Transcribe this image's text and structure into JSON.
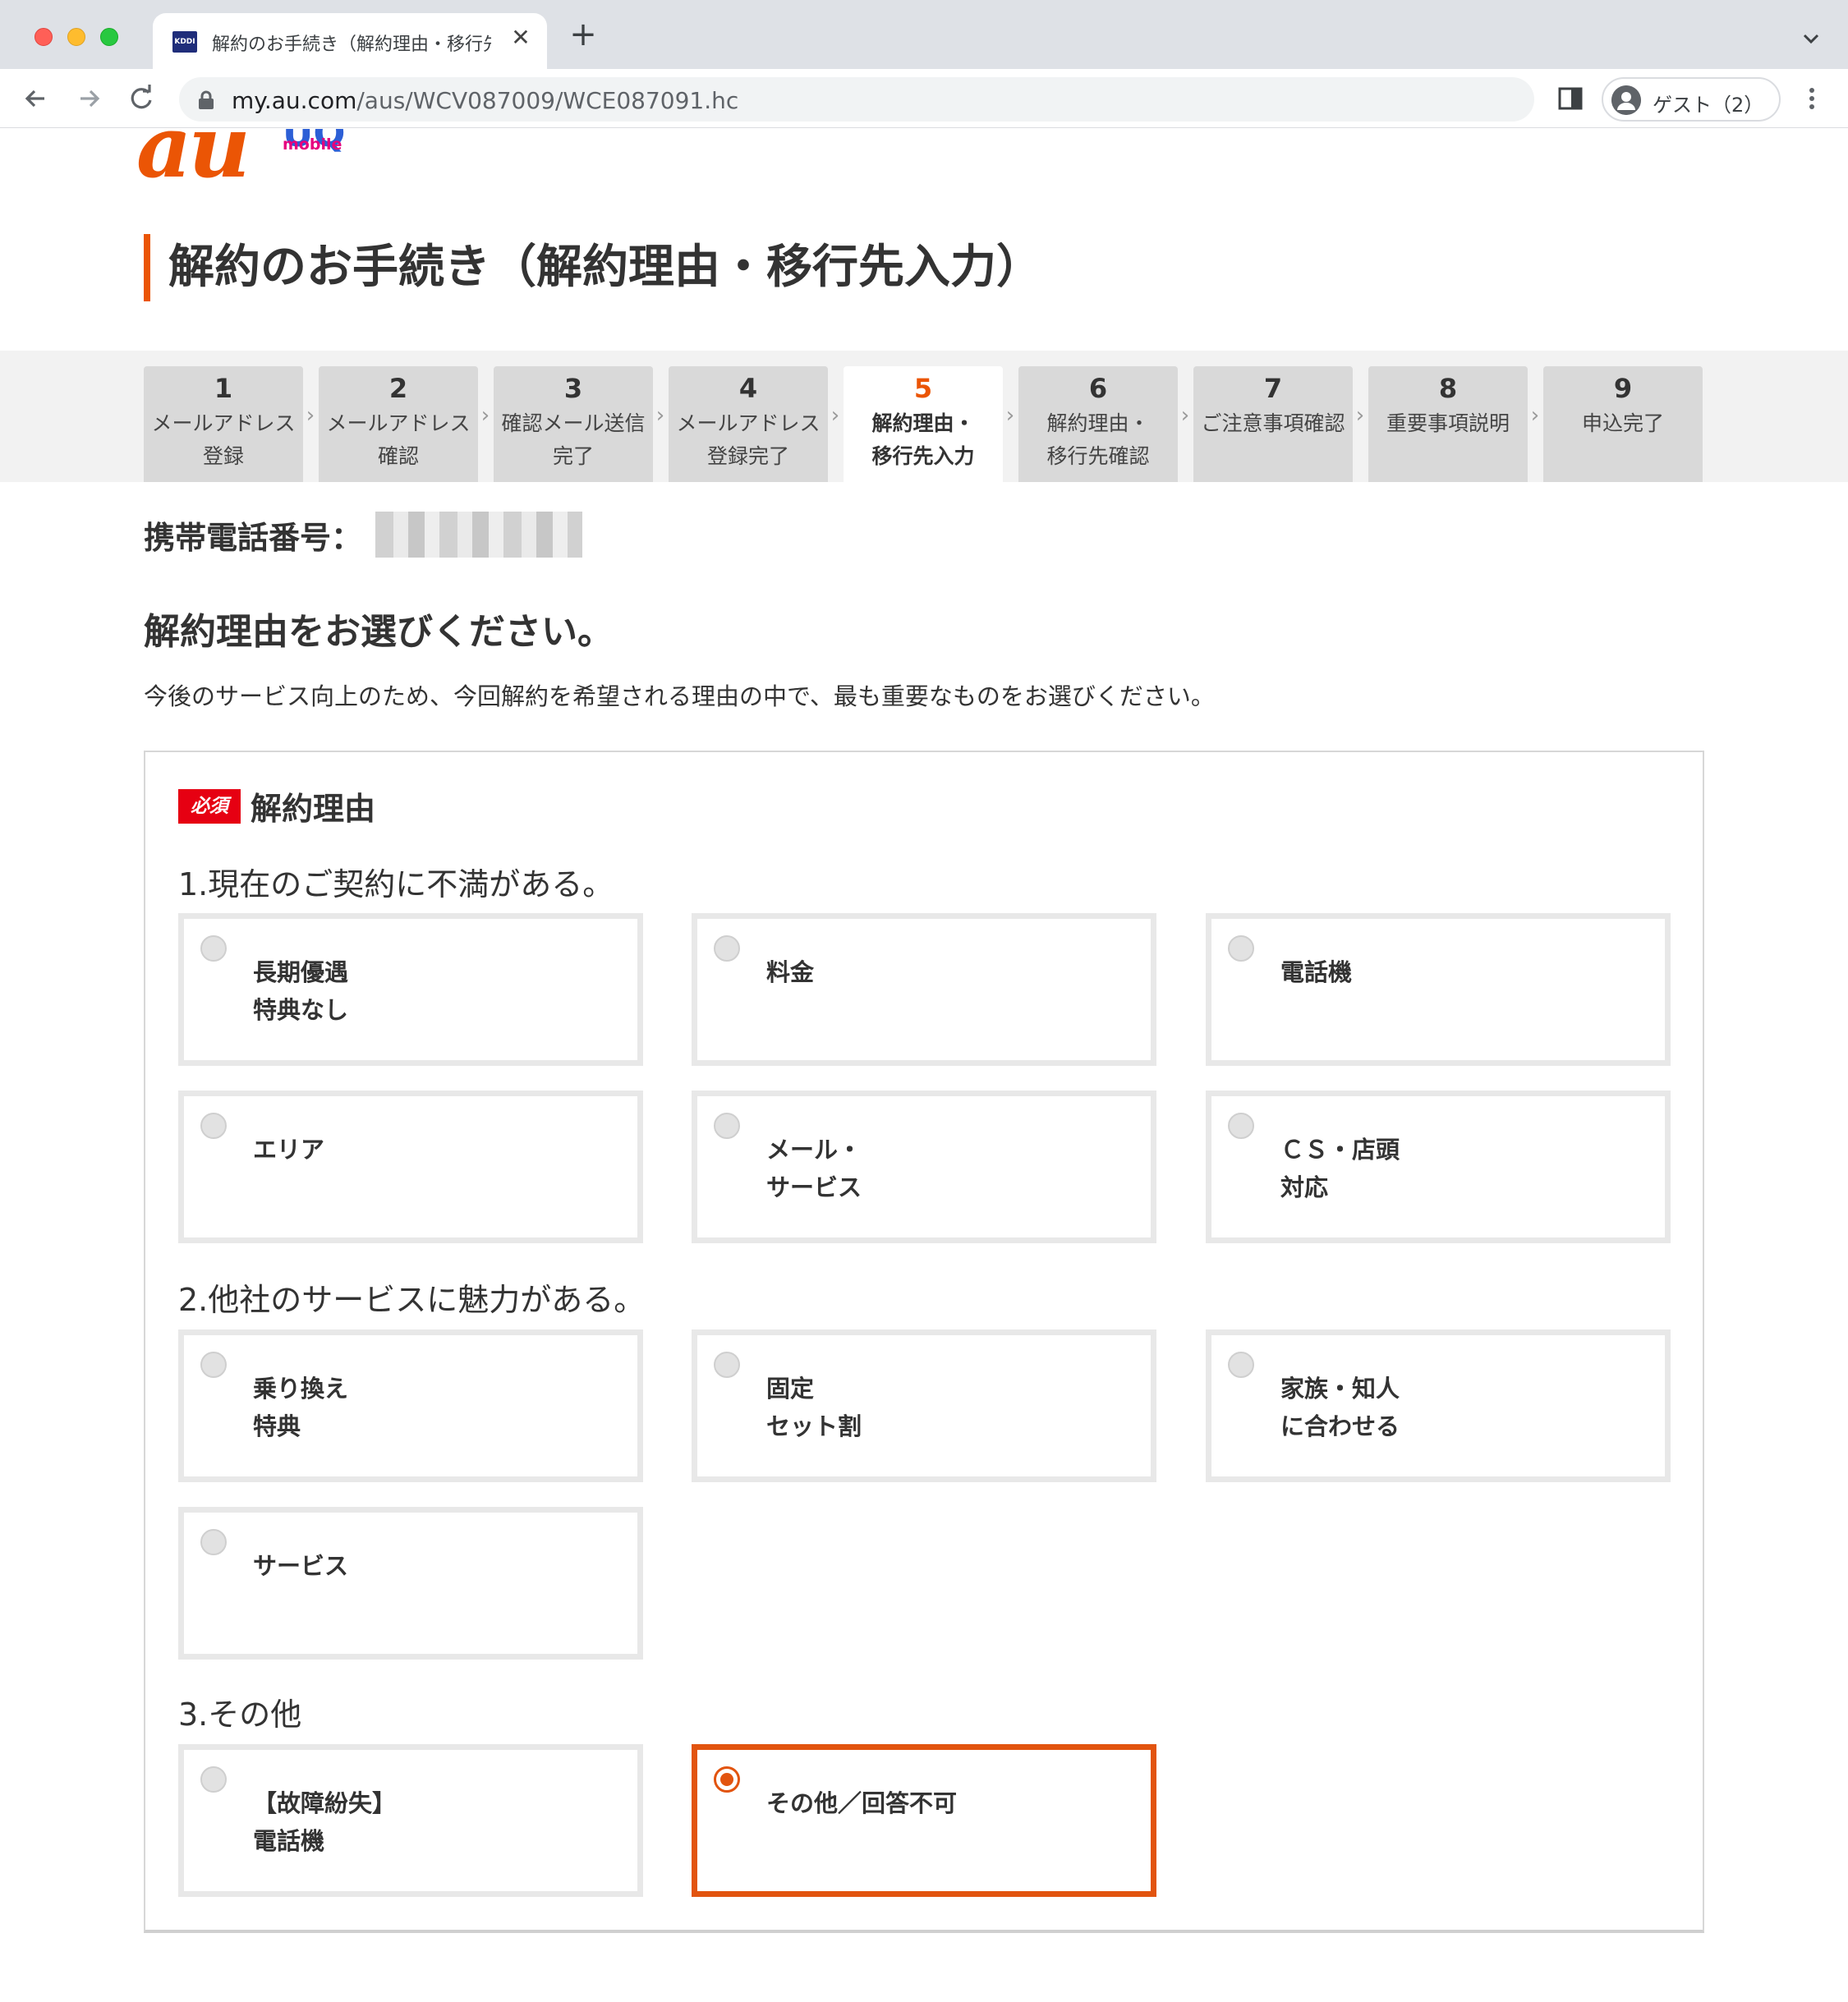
{
  "browser": {
    "tab_title": "解約のお手続き（解約理由・移行先",
    "tab_favicon_text": "KDDI",
    "new_tab_icon": "plus-icon",
    "url_host": "my.au.com",
    "url_path": "/aus/WCV087009/WCE087091.hc",
    "profile_label": "ゲスト（2）"
  },
  "brand": {
    "primary_logo": "au",
    "secondary_logo_mark": "UQ",
    "secondary_logo_text": "mobile",
    "accent_color": "#eb5505"
  },
  "page_title": "解約のお手続き（解約理由・移行先入力）",
  "steps": [
    {
      "num": "1",
      "label": "メールアドレス\n登録",
      "active": false
    },
    {
      "num": "2",
      "label": "メールアドレス\n確認",
      "active": false
    },
    {
      "num": "3",
      "label": "確認メール送信\n完了",
      "active": false
    },
    {
      "num": "4",
      "label": "メールアドレス\n登録完了",
      "active": false
    },
    {
      "num": "5",
      "label": "解約理由・\n移行先入力",
      "active": true
    },
    {
      "num": "6",
      "label": "解約理由・\n移行先確認",
      "active": false
    },
    {
      "num": "7",
      "label": "ご注意事項確認",
      "active": false
    },
    {
      "num": "8",
      "label": "重要事項説明",
      "active": false
    },
    {
      "num": "9",
      "label": "申込完了",
      "active": false
    }
  ],
  "phone": {
    "label": "携帯電話番号："
  },
  "section": {
    "heading": "解約理由をお選びください。",
    "description": "今後のサービス向上のため、今回解約を希望される理由の中で、最も重要なものをお選びください。"
  },
  "form": {
    "required_badge": "必須",
    "field_label": "解約理由",
    "groups": [
      {
        "title": "1.現在のご契約に不満がある。",
        "options": [
          {
            "label": "長期優遇\n特典なし",
            "selected": false
          },
          {
            "label": "料金",
            "selected": false
          },
          {
            "label": "電話機",
            "selected": false
          },
          {
            "label": "エリア",
            "selected": false
          },
          {
            "label": "メール・\nサービス",
            "selected": false
          },
          {
            "label": "ＣＳ・店頭\n対応",
            "selected": false
          }
        ]
      },
      {
        "title": "2.他社のサービスに魅力がある。",
        "options": [
          {
            "label": "乗り換え\n特典",
            "selected": false
          },
          {
            "label": "固定\nセット割",
            "selected": false
          },
          {
            "label": "家族・知人\nに合わせる",
            "selected": false
          },
          {
            "label": "サービス",
            "selected": false
          }
        ]
      },
      {
        "title": "3.その他",
        "options": [
          {
            "label": "【故障紛失】\n電話機",
            "selected": false
          },
          {
            "label": "その他／回答不可",
            "selected": true
          }
        ]
      }
    ]
  }
}
